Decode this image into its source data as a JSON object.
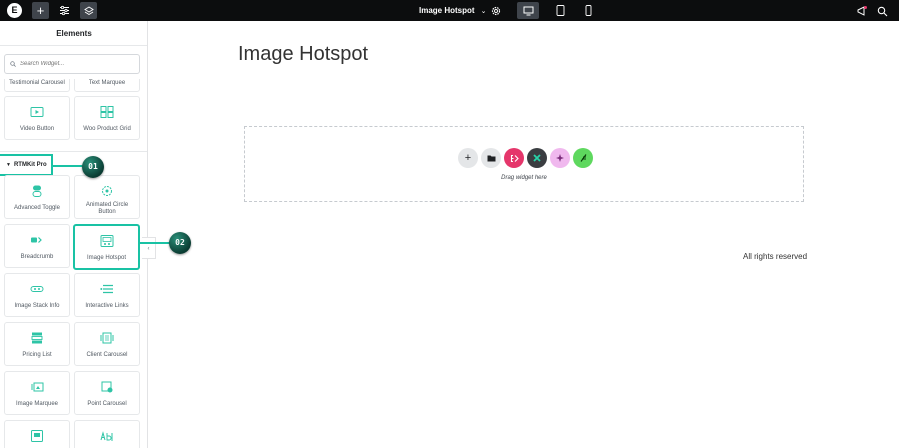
{
  "topbar": {
    "add_label": "+",
    "page_title": "Image Hotspot",
    "title_chevron": "⌄",
    "logo_letter": "E"
  },
  "sidebar": {
    "title": "Elements",
    "search_placeholder": "Search Widget...",
    "top_cut_tiles": [
      "Testimonial Carousel",
      "Text Marquee"
    ],
    "tiles_row1": [
      "Video Button",
      "Woo Product Grid"
    ],
    "category": "RTMKit Pro",
    "widgets": [
      "Advanced Toggle",
      "Animated Circle Button",
      "Breadcrumb",
      "Image Hotspot",
      "Image Stack Info",
      "Interactive Links",
      "Pricing List",
      "Client Carousel",
      "Image Marquee",
      "Point Carousel"
    ],
    "collapse_label": "‹"
  },
  "callouts": [
    "01",
    "02"
  ],
  "canvas": {
    "page_heading": "Image Hotspot",
    "drop_text": "Drag widget here",
    "add_label": "+",
    "footer_text": "All rights reserved"
  },
  "colors": {
    "topbar": "#0c0d0e",
    "accent": "#19c2a4",
    "widget_icon": "#2ec4a6",
    "callout": "#0b3d33"
  }
}
